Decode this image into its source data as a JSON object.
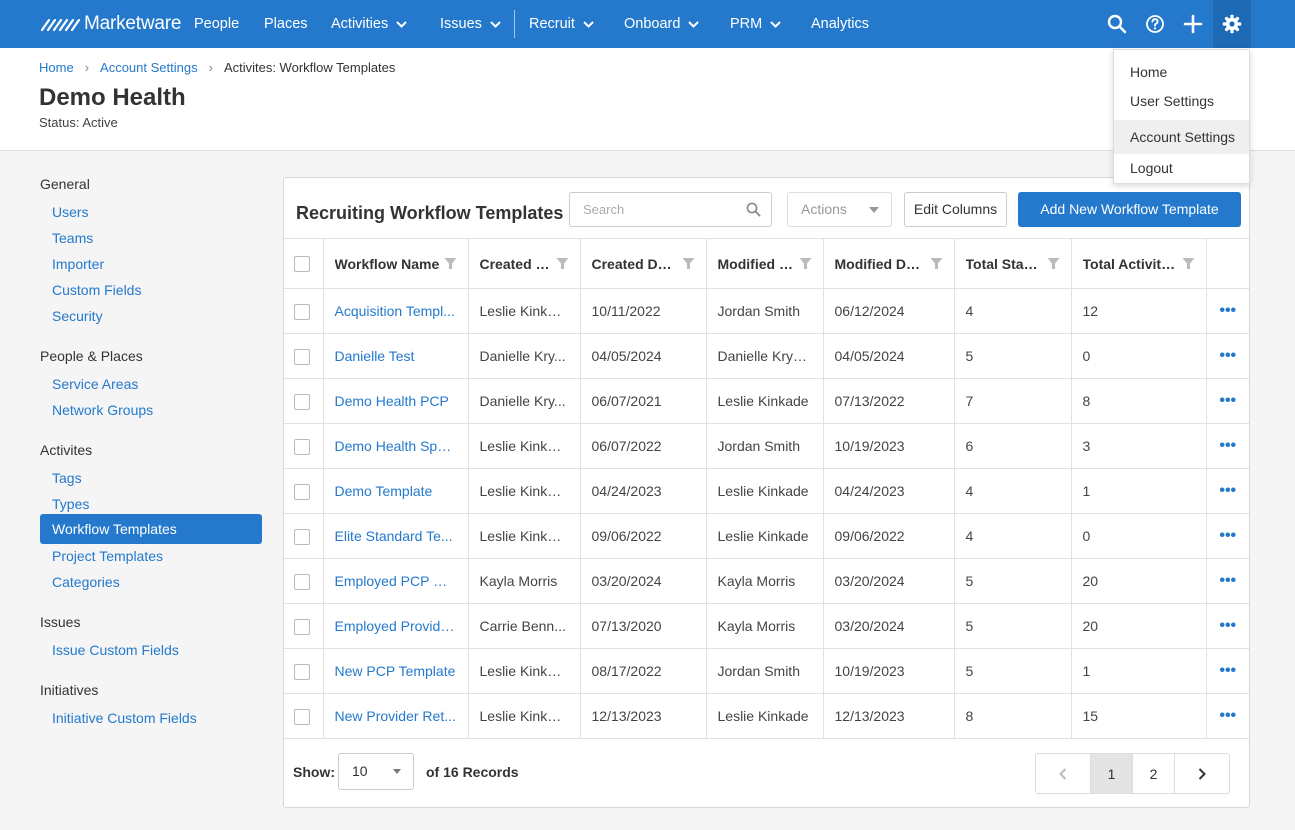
{
  "brand": {
    "name": "Marketware"
  },
  "nav": {
    "items": [
      {
        "label": "People"
      },
      {
        "label": "Places"
      },
      {
        "label": "Activities"
      },
      {
        "label": "Issues"
      },
      {
        "label": "Recruit"
      },
      {
        "label": "Onboard"
      },
      {
        "label": "PRM"
      },
      {
        "label": "Analytics"
      }
    ],
    "icons": [
      "search-icon",
      "help-icon",
      "plus-icon",
      "gear-icon"
    ]
  },
  "user_menu": {
    "items": [
      {
        "label": "Home"
      },
      {
        "label": "User Settings"
      },
      {
        "label": "Account Settings"
      },
      {
        "label": "Logout"
      }
    ],
    "active": "Account Settings"
  },
  "breadcrumb": {
    "home": "Home",
    "account_settings": "Account Settings",
    "current": "Activites: Workflow Templates"
  },
  "header": {
    "title": "Demo Health",
    "status": "Status: Active"
  },
  "sidebar": {
    "general": "General",
    "general_items": [
      "Users",
      "Teams",
      "Importer",
      "Custom Fields",
      "Security"
    ],
    "people_places": "People & Places",
    "people_places_items": [
      "Service Areas",
      "Network Groups"
    ],
    "activites": "Activites",
    "activites_items": [
      "Tags",
      "Types",
      "Workflow Templates",
      "Project Templates",
      "Categories"
    ],
    "issues": "Issues",
    "issues_items": [
      "Issue Custom Fields"
    ],
    "initiatives": "Initiatives",
    "initiatives_items": [
      "Initiative Custom Fields"
    ],
    "active_item": "Workflow Templates"
  },
  "panel": {
    "title": "Recruiting Workflow Templates",
    "search_placeholder": "Search",
    "actions_label": "Actions",
    "edit_columns_label": "Edit Columns",
    "add_label": "Add New Workflow Template"
  },
  "table": {
    "columns": [
      "Workflow Name",
      "Created By",
      "Created Date",
      "Modified By",
      "Modified Date",
      "Total Stages",
      "Total Activities"
    ],
    "rows": [
      [
        "Acquisition Templ...",
        "Leslie Kinkade",
        "10/11/2022",
        "Jordan Smith",
        "06/12/2024",
        "4",
        "12"
      ],
      [
        "Danielle Test",
        "Danielle Kry...",
        "04/05/2024",
        "Danielle Krys...",
        "04/05/2024",
        "5",
        "0"
      ],
      [
        "Demo Health PCP",
        "Danielle Kry...",
        "06/07/2021",
        "Leslie Kinkade",
        "07/13/2022",
        "7",
        "8"
      ],
      [
        "Demo Health Spe...",
        "Leslie Kinkade",
        "06/07/2022",
        "Jordan Smith",
        "10/19/2023",
        "6",
        "3"
      ],
      [
        "Demo Template",
        "Leslie Kinkade",
        "04/24/2023",
        "Leslie Kinkade",
        "04/24/2023",
        "4",
        "1"
      ],
      [
        "Elite Standard Te...",
        "Leslie Kinkade",
        "09/06/2022",
        "Leslie Kinkade",
        "09/06/2022",
        "4",
        "0"
      ],
      [
        "Employed PCP Re...",
        "Kayla Morris",
        "03/20/2024",
        "Kayla Morris",
        "03/20/2024",
        "5",
        "20"
      ],
      [
        "Employed Provide...",
        "Carrie Benn...",
        "07/13/2020",
        "Kayla Morris",
        "03/20/2024",
        "5",
        "20"
      ],
      [
        "New PCP Template",
        "Leslie Kinkade",
        "08/17/2022",
        "Jordan Smith",
        "10/19/2023",
        "5",
        "1"
      ],
      [
        "New Provider Ret...",
        "Leslie Kinkade",
        "12/13/2023",
        "Leslie Kinkade",
        "12/13/2023",
        "8",
        "15"
      ]
    ],
    "row_menu": "•••"
  },
  "footer": {
    "show_label": "Show:",
    "page_size": "10",
    "records": "of 16 Records",
    "pages": [
      "1",
      "2"
    ],
    "current_page": "1"
  },
  "colors": {
    "primary": "#2479cc",
    "nav_bg": "#2479cc",
    "active_bg": "#2479cc"
  }
}
